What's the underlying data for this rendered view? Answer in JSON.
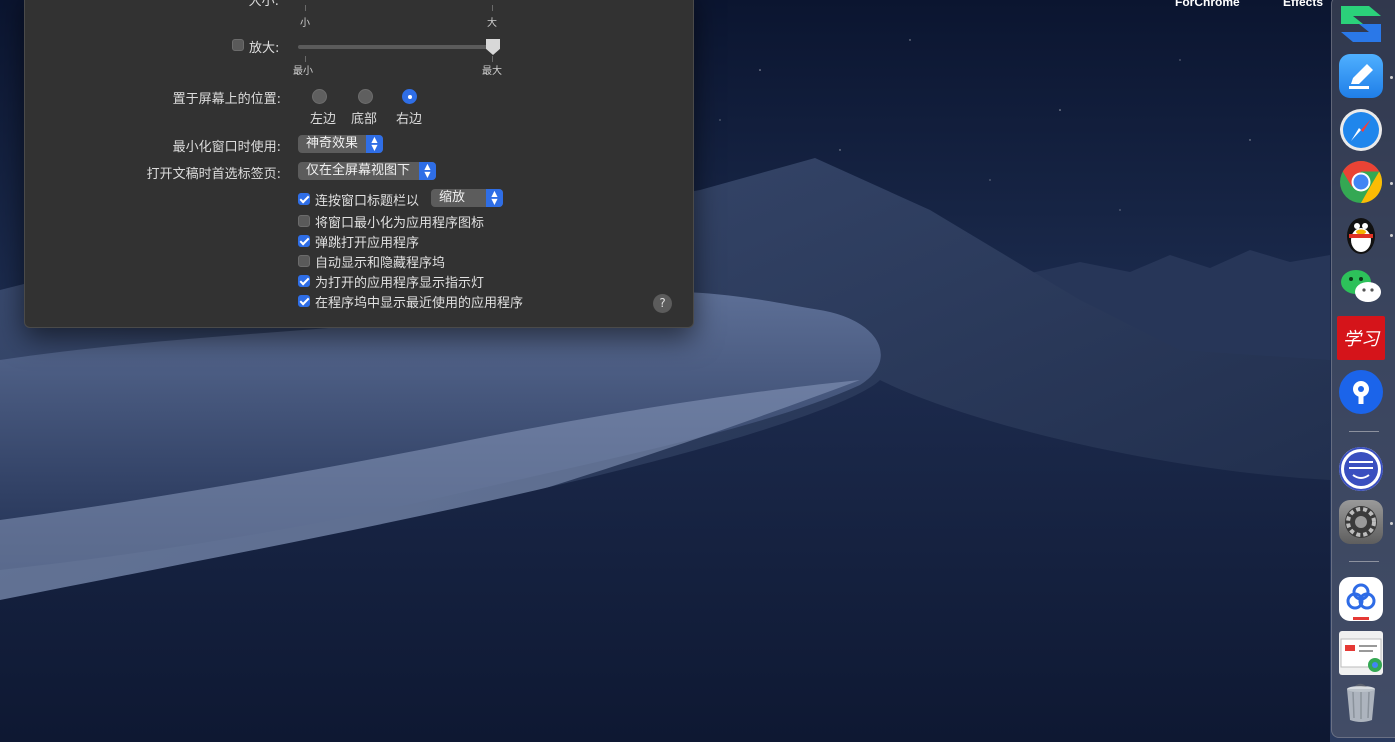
{
  "desktop": {
    "labels": [
      "ForChrome",
      "Effects"
    ]
  },
  "prefs": {
    "size": {
      "label": "大小:",
      "min_label": "小",
      "max_label": "大"
    },
    "magnification": {
      "label": "放大:",
      "checked": false,
      "min_label": "最小",
      "max_label": "最大",
      "value": 1.0
    },
    "position": {
      "label": "置于屏幕上的位置:",
      "options": [
        "左边",
        "底部",
        "右边"
      ],
      "selected": "右边"
    },
    "minimize_effect": {
      "label": "最小化窗口时使用:",
      "value": "神奇效果"
    },
    "prefer_tabs": {
      "label": "打开文稿时首选标签页:",
      "value": "仅在全屏幕视图下"
    },
    "double_click": {
      "label": "连按窗口标题栏以",
      "checked": true,
      "value": "缩放"
    },
    "checkboxes": [
      {
        "label": "将窗口最小化为应用程序图标",
        "checked": false
      },
      {
        "label": "弹跳打开应用程序",
        "checked": true
      },
      {
        "label": "自动显示和隐藏程序坞",
        "checked": false
      },
      {
        "label": "为打开的应用程序显示指示灯",
        "checked": true
      },
      {
        "label": "在程序坞中显示最近使用的应用程序",
        "checked": true
      }
    ],
    "help": "?"
  },
  "dock": {
    "apps": [
      {
        "name": "app-s-icon",
        "color": "#2bd17a",
        "running": false
      },
      {
        "name": "notes-pen-icon",
        "color": "#2f95f0",
        "running": true
      },
      {
        "name": "safari-icon",
        "color": "#2a82e8",
        "running": false
      },
      {
        "name": "chrome-icon",
        "color": "#e04a3a",
        "running": true
      },
      {
        "name": "qq-penguin-icon",
        "color": "#111111",
        "running": true
      },
      {
        "name": "wechat-icon",
        "color": "#2dc15a",
        "running": false
      },
      {
        "name": "xuexi-icon",
        "color": "#d5141a",
        "running": false
      },
      {
        "name": "keyhole-icon",
        "color": "#1b64ea",
        "running": false
      },
      {
        "name": "robinhood-icon",
        "color": "#3a4fbf",
        "running": false
      },
      {
        "name": "system-preferences-icon",
        "color": "#8c8c8c",
        "running": true
      },
      {
        "name": "baidu-netdisk-icon",
        "color": "#ffffff",
        "running": false
      },
      {
        "name": "chrome-window-icon",
        "color": "#e8e8e8",
        "running": false
      },
      {
        "name": "trash-icon",
        "color": "#9aa0a6",
        "running": false
      }
    ],
    "xuexi_text": "学习"
  }
}
